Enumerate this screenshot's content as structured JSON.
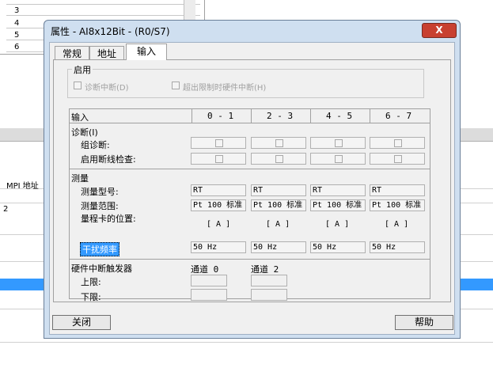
{
  "background": {
    "rows": [
      "3",
      "4",
      "5",
      "6"
    ],
    "mpi_label": "MPI 地址",
    "value_2": "2"
  },
  "dialog": {
    "title": "属性 - AI8x12Bit - (R0/S7)",
    "close_glyph": "X",
    "tabs": [
      {
        "label": "常规"
      },
      {
        "label": "地址"
      },
      {
        "label": "输入"
      }
    ],
    "enable": {
      "label": "启用",
      "diag_interrupt": "诊断中断(D)",
      "limit_interrupt": "超出限制时硬件中断(H)"
    },
    "table": {
      "header_label": "输入",
      "columns": [
        "0 - 1",
        "2 - 3",
        "4 - 5",
        "6 - 7"
      ],
      "diag_section": "诊断(I)",
      "group_diag": "组诊断:",
      "wire_break": "启用断线检查:",
      "measure_section": "测量",
      "measure_type": "测量型号:",
      "measure_range": "测量范围:",
      "range_card": "量程卡的位置:",
      "type_values": [
        "RT",
        "RT",
        "RT",
        "RT"
      ],
      "range_values": [
        "Pt 100 标准",
        "Pt 100 标准",
        "Pt 100 标准",
        "Pt 100 标准"
      ],
      "card_values": [
        "[ A ]",
        "[ A ]",
        "[ A ]",
        "[ A ]"
      ],
      "interference_label": "干扰频率",
      "freq_values": [
        "50 Hz",
        "50 Hz",
        "50 Hz",
        "50 Hz"
      ],
      "hw_section": "硬件中断触发器",
      "upper": "上限:",
      "lower": "下限:",
      "channel0": "通道 0",
      "channel2": "通道 2"
    },
    "buttons": {
      "close": "关闭",
      "help": "帮助"
    }
  }
}
